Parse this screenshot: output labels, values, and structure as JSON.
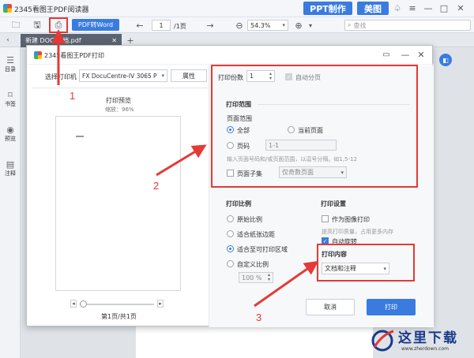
{
  "app": {
    "title": "2345看图王PDF阅读器",
    "ppt_btn": "PPT制作",
    "beautify_btn": "美图"
  },
  "toolbar": {
    "pdf_to_word": "PDF转Word",
    "page_current": "1",
    "page_total": "/1页",
    "zoom": "54.3%",
    "search_placeholder": "查找"
  },
  "tabs": [
    {
      "label": "新建 DOC 文档.pdf"
    }
  ],
  "sidebar": {
    "items": [
      {
        "label": "目录"
      },
      {
        "label": "书签"
      },
      {
        "label": "预览"
      },
      {
        "label": "注释"
      }
    ]
  },
  "dialog": {
    "title": "2345看图王PDF打印",
    "printer_label": "选择打印机",
    "printer_value": "FX DocuCentre-IV 3065 P",
    "properties_btn": "属性",
    "preview_title": "打印预览",
    "preview_zoom": "缩放：96%",
    "page_indicator": "第1页/共1页",
    "copies_label": "打印份数",
    "copies_value": "1",
    "collate_label": "自动分页",
    "range": {
      "title": "打印范围",
      "subtitle": "页面范围",
      "all": "全部",
      "current": "当前页面",
      "pages_label": "页码",
      "pages_value": "1-1",
      "hint": "输入页面号码和/或页面范围，以逗号分隔。如1,5-12",
      "subset_label": "页面子集",
      "subset_value": "仅奇数页面"
    },
    "scale": {
      "title": "打印比例",
      "original": "原始比例",
      "fit_paper": "适合纸张边距",
      "fit_print": "适合至可打印区域",
      "custom": "自定义比例",
      "custom_value": "100 %"
    },
    "settings": {
      "title": "打印设置",
      "as_image": "作为图像打印",
      "as_image_hint": "提高打印质量，占用更多内存",
      "auto_rotate": "自动旋转",
      "content_title": "打印内容",
      "content_value": "文档和注释"
    },
    "cancel_btn": "取消",
    "print_btn": "打印"
  },
  "annotations": {
    "n1": "1",
    "n2": "2",
    "n3": "3"
  },
  "watermark": {
    "text": "这里下载",
    "url": "www.zherdown.com"
  },
  "colors": {
    "accent": "#3a7be0",
    "annotation_red": "#e53935"
  }
}
